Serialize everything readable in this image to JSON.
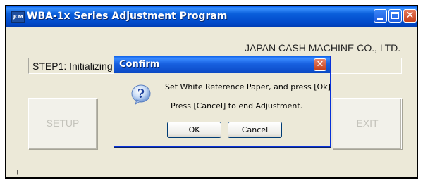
{
  "window": {
    "icon_text": "JCM",
    "title": "WBA-1x Series Adjustment Program",
    "company": "JAPAN CASH MACHINE CO., LTD.",
    "step_text": "STEP1: Initializing",
    "setup_label": "SETUP",
    "exit_label": "EXIT",
    "status_text": "-+-"
  },
  "dialog": {
    "title": "Confirm",
    "close_glyph": "✕",
    "message_line1": "Set White Reference Paper, and press [Ok]",
    "message_line2": "Press [Cancel] to end Adjustment.",
    "ok_label": "OK",
    "cancel_label": "Cancel",
    "icon": "question-icon"
  },
  "colors": {
    "titlebar_blue": "#0a5fdc",
    "window_face": "#ece9d8",
    "close_red": "#c7401b",
    "disabled_text": "#c4c3bb"
  }
}
